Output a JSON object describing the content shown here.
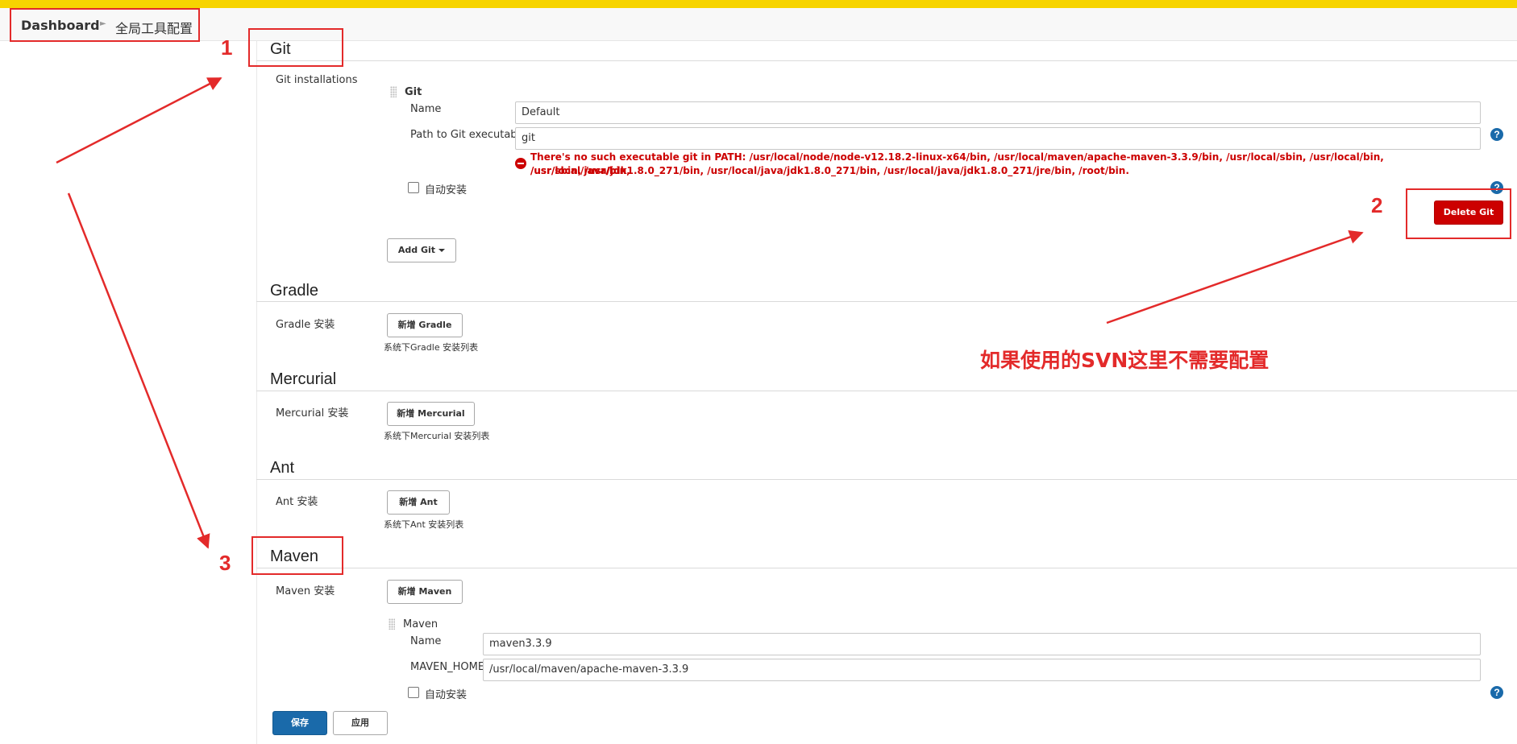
{
  "breadcrumb": {
    "home": "Dashboard",
    "current": "全局工具配置"
  },
  "annotations": {
    "num1": "1",
    "num2": "2",
    "num3": "3",
    "note": "如果使用的SVN这里不需要配置",
    "color": "#e32a2a"
  },
  "git": {
    "title": "Git",
    "installations_label": "Git installations",
    "entry_title": "Git",
    "name_label": "Name",
    "name_value": "Default",
    "path_label": "Path to Git executable",
    "path_value": "git",
    "error_line1": "There's no such executable git in PATH: /usr/local/node/node-v12.18.2-linux-x64/bin, /usr/local/maven/apache-maven-3.3.9/bin, /usr/local/sbin, /usr/local/bin, /usr/sbin, /usr/bin,",
    "error_line2": "/usr/local/java/jdk1.8.0_271/bin, /usr/local/java/jdk1.8.0_271/bin, /usr/local/java/jdk1.8.0_271/jre/bin, /root/bin.",
    "auto_install_label": "自动安装",
    "delete_button": "Delete Git",
    "add_button": "Add Git"
  },
  "gradle": {
    "title": "Gradle",
    "row_label": "Gradle 安装",
    "add_button": "新增 Gradle",
    "hint": "系统下Gradle 安装列表"
  },
  "mercurial": {
    "title": "Mercurial",
    "row_label": "Mercurial 安装",
    "add_button": "新增 Mercurial",
    "hint": "系统下Mercurial 安装列表"
  },
  "ant": {
    "title": "Ant",
    "row_label": "Ant 安装",
    "add_button": "新增 Ant",
    "hint": "系统下Ant 安装列表"
  },
  "maven": {
    "title": "Maven",
    "row_label": "Maven 安装",
    "add_button": "新增 Maven",
    "entry_title": "Maven",
    "name_label": "Name",
    "name_value": "maven3.3.9",
    "home_label": "MAVEN_HOME",
    "home_value": "/usr/local/maven/apache-maven-3.3.9",
    "auto_install_label": "自动安装"
  },
  "footer": {
    "save_button": "保存",
    "apply_button": "应用"
  },
  "help_glyph": "?",
  "colors": {
    "accent": "#1a6aaa",
    "danger": "#cc0000",
    "topbar": "#f7d400"
  }
}
